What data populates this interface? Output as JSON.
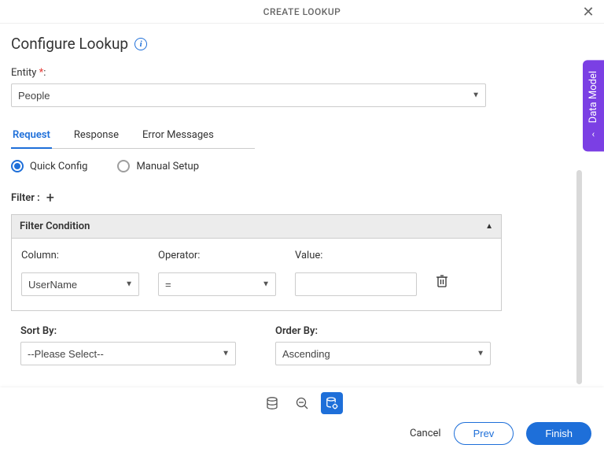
{
  "header": {
    "title": "CREATE LOOKUP"
  },
  "page": {
    "title": "Configure Lookup",
    "entity_label": "Entity",
    "entity_value": "People"
  },
  "tabs": {
    "request": "Request",
    "response": "Response",
    "errors": "Error Messages"
  },
  "config_mode": {
    "quick": "Quick Config",
    "manual": "Manual Setup"
  },
  "filter": {
    "label": "Filter :",
    "panel_title": "Filter Condition",
    "column_label": "Column:",
    "operator_label": "Operator:",
    "value_label": "Value:",
    "column_value": "UserName",
    "operator_value": "=",
    "value_value": ""
  },
  "sort": {
    "sort_by_label": "Sort By:",
    "sort_by_value": "--Please Select--",
    "order_by_label": "Order By:",
    "order_by_value": "Ascending"
  },
  "footer": {
    "cancel": "Cancel",
    "prev": "Prev",
    "finish": "Finish"
  },
  "side": {
    "label": "Data Model"
  }
}
